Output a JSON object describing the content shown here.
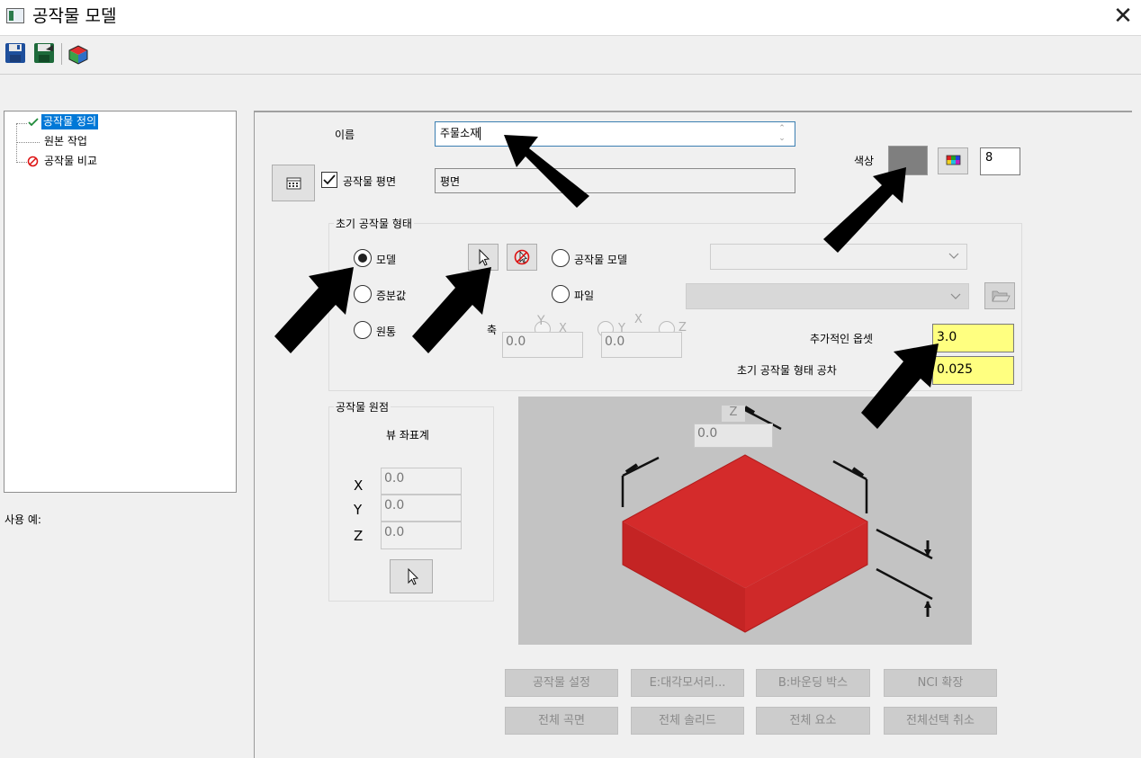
{
  "window": {
    "title": "공작물 모델",
    "close_glyph": "✕"
  },
  "toolbar": {
    "buttons": [
      "save-icon",
      "save-as-icon",
      "stock-model-icon"
    ]
  },
  "tree": {
    "items": [
      {
        "label": "공작물 정의",
        "icon": "checkmark-icon",
        "selected": true
      },
      {
        "label": "원본 작업",
        "icon": "none",
        "selected": false
      },
      {
        "label": "공작물 비교",
        "icon": "no-entry-icon",
        "selected": false
      }
    ]
  },
  "usage": {
    "label": "사용 예:"
  },
  "form": {
    "name_label": "이름",
    "name_value": "주물소재",
    "color_label": "색상",
    "color_swatch": "#7f7f7f",
    "color_number": "8",
    "stock_plane_label": "공작물 평면",
    "stock_plane_checked": true,
    "plane_value": "평면"
  },
  "initial_shape": {
    "group_label": "초기 공작물 형태",
    "radio_model": "모델",
    "radio_increment": "증분값",
    "radio_cylinder": "원통",
    "radio_stock_model": "공작물 모델",
    "radio_file": "파일",
    "axis_label": "축",
    "axis_y": "Y",
    "axis_x": "X",
    "axis_z": "Z",
    "field1": "0.0",
    "field2": "0.0",
    "offset_label": "추가적인 옵셋",
    "offset_value": "3.0",
    "tolerance_label": "초기 공작물 형태 공차",
    "tolerance_value": "0.025"
  },
  "origin": {
    "group_label": "공작물 원점",
    "view_label": "뷰 좌표계",
    "x_label": "X",
    "y_label": "Y",
    "z_label": "Z",
    "x_value": "0.0",
    "y_value": "0.0",
    "z_value": "0.0"
  },
  "preview": {
    "z_tag": "Z",
    "z_value": "0.0",
    "box_color": "#d42b2b"
  },
  "buttons": {
    "set_stock": "공작물 설정",
    "diagonal": "E:대각모서리...",
    "bounding_box": "B:바운딩 박스",
    "nci_extents": "NCI 확장",
    "all_surfaces": "전체 곡면",
    "all_solids": "전체 솔리드",
    "all_entities": "전체 요소",
    "unselect_all": "전체선택 취소"
  }
}
